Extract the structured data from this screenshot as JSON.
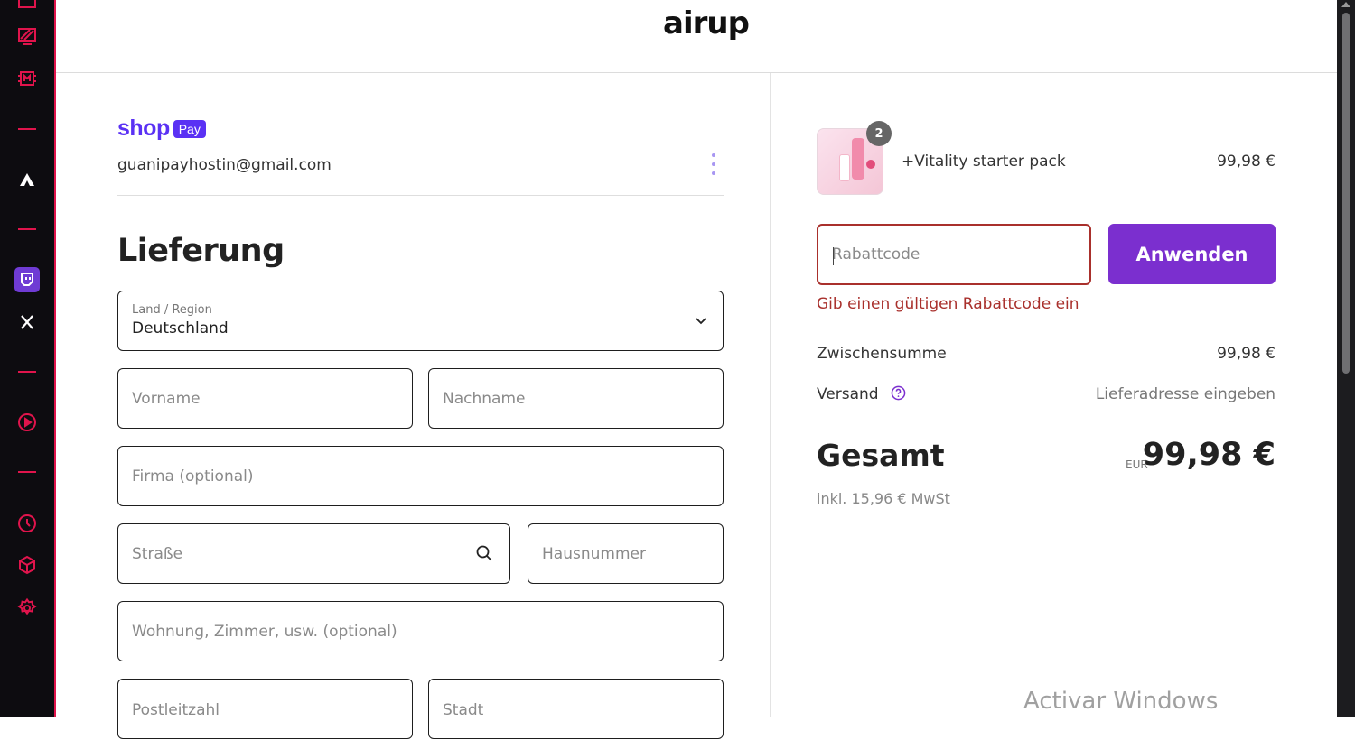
{
  "sidebar": {
    "icons": [
      "media-icon",
      "screen-share-icon",
      "memory-chip-icon",
      "aria-icon",
      "twitch-icon",
      "x-icon",
      "player-icon",
      "history-icon",
      "cube-icon",
      "settings-icon"
    ],
    "accent_color": "#e0144c"
  },
  "header": {
    "logo": "airup"
  },
  "shop_pay": {
    "shop_label": "shop",
    "pay_label": "Pay",
    "email": "guanipayhostin@gmail.com"
  },
  "delivery": {
    "title": "Lieferung",
    "country": {
      "label": "Land / Region",
      "value": "Deutschland"
    },
    "first_name": {
      "placeholder": "Vorname"
    },
    "last_name": {
      "placeholder": "Nachname"
    },
    "company": {
      "placeholder": "Firma (optional)"
    },
    "street": {
      "placeholder": "Straße"
    },
    "house_number": {
      "placeholder": "Hausnummer"
    },
    "apartment": {
      "placeholder": "Wohnung, Zimmer, usw. (optional)"
    },
    "postal_code": {
      "placeholder": "Postleitzahl"
    },
    "city": {
      "placeholder": "Stadt"
    }
  },
  "summary": {
    "product": {
      "name": "+Vitality starter pack",
      "price": "99,98 €",
      "quantity": "2"
    },
    "discount": {
      "placeholder": "Rabattcode",
      "apply_label": "Anwenden",
      "error": "Gib einen gültigen Rabattcode ein"
    },
    "subtotal": {
      "label": "Zwischensumme",
      "value": "99,98 €"
    },
    "shipping": {
      "label": "Versand",
      "value": "Lieferadresse eingeben"
    },
    "total": {
      "label": "Gesamt",
      "currency": "EUR",
      "amount": "99,98 €",
      "tax_note": "inkl. 15,96 € MwSt"
    },
    "colors": {
      "button": "#7b2fcf",
      "error": "#a9302c",
      "shop_pay": "#5a31f4"
    }
  },
  "os": {
    "watermark": "Activar Windows"
  }
}
